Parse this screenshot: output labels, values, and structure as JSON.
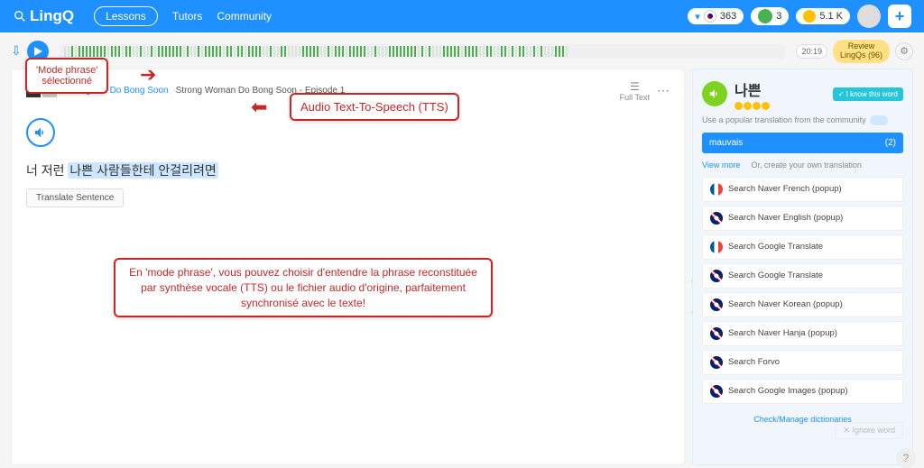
{
  "header": {
    "logo": "LingQ",
    "nav": {
      "lessons": "Lessons",
      "tutors": "Tutors",
      "community": "Community"
    },
    "stats": {
      "streak": "363",
      "apple": "3",
      "coins": "5.1 K"
    }
  },
  "toolbar": {
    "progress_time": "20:19",
    "review_label": "Review",
    "review_lingqs": "LingQs (96)"
  },
  "lesson": {
    "course_link": "Strong Girl Do Bong Soon",
    "title": "Strong Woman Do Bong Soon - Episode 1",
    "fulltext": "Full Text",
    "sentence_prefix": "너 저런 ",
    "sentence_hl": "나쁜 사람들한테 안걸리려면",
    "translate_btn": "Translate Sentence"
  },
  "annotations": {
    "anno1_line1": "'Mode phrase'",
    "anno1_line2": "sélectionné",
    "anno2": "Audio Text-To-Speech (TTS)",
    "anno3": "En 'mode phrase', vous pouvez choisir d'entendre la phrase reconstituée par synthèse vocale (TTS) ou le fichier audio d'origine, parfaitement synchronisé avec le texte!"
  },
  "panel": {
    "word": "나쁜",
    "know_btn": "✓ I know this word",
    "subtext": "Use a popular translation from the community",
    "tag": "mauvais",
    "tag_count": "(2)",
    "view_more": "View more",
    "or_create": "Or, create your own translation",
    "dicts": [
      "Search Naver French (popup)",
      "Search Naver English (popup)",
      "Search Google Translate",
      "Search Google Translate",
      "Search Naver Korean (popup)",
      "Search Naver Hanja (popup)",
      "Search Forvo",
      "Search Google Images (popup)"
    ],
    "dict_flags": [
      "fr",
      "uk",
      "fr",
      "uk",
      "uk",
      "uk",
      "uk",
      "uk"
    ],
    "manage": "Check/Manage dictionaries",
    "ignore": "✕ Ignore word"
  }
}
